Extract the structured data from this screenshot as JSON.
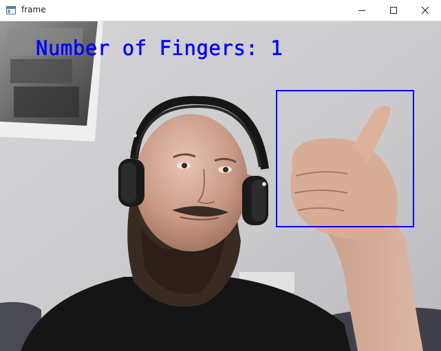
{
  "window": {
    "title": "frame",
    "controls": {
      "minimize_icon": "minimize-icon",
      "maximize_icon": "maximize-icon",
      "close_icon": "close-icon"
    }
  },
  "frame": {
    "overlay_text": "Number of Fingers: 1",
    "overlay_color": "#0000ff",
    "roi_color": "#0000ff"
  }
}
